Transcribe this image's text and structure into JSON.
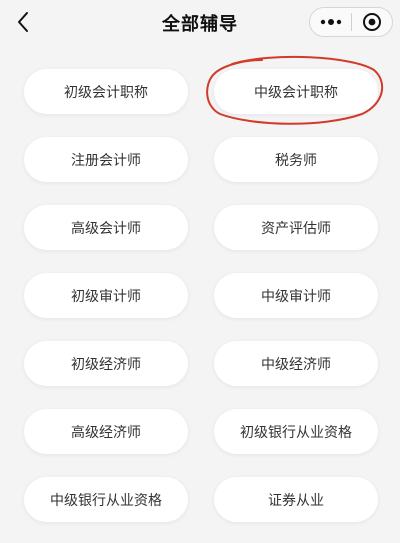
{
  "navbar": {
    "title": "全部辅导",
    "back_icon": "back-chevron-icon",
    "more_icon": "more-dots-icon",
    "close_icon": "target-close-icon"
  },
  "courses": [
    {
      "label": "初级会计职称"
    },
    {
      "label": "中级会计职称",
      "circled": true
    },
    {
      "label": "注册会计师"
    },
    {
      "label": "税务师"
    },
    {
      "label": "高级会计师"
    },
    {
      "label": "资产评估师"
    },
    {
      "label": "初级审计师"
    },
    {
      "label": "中级审计师"
    },
    {
      "label": "初级经济师"
    },
    {
      "label": "中级经济师"
    },
    {
      "label": "高级经济师"
    },
    {
      "label": "初级银行从业资格"
    },
    {
      "label": "中级银行从业资格"
    },
    {
      "label": "证券从业"
    }
  ],
  "colors": {
    "background": "#f4f4f4",
    "chip": "#ffffff",
    "annotation": "#d23a2a"
  }
}
